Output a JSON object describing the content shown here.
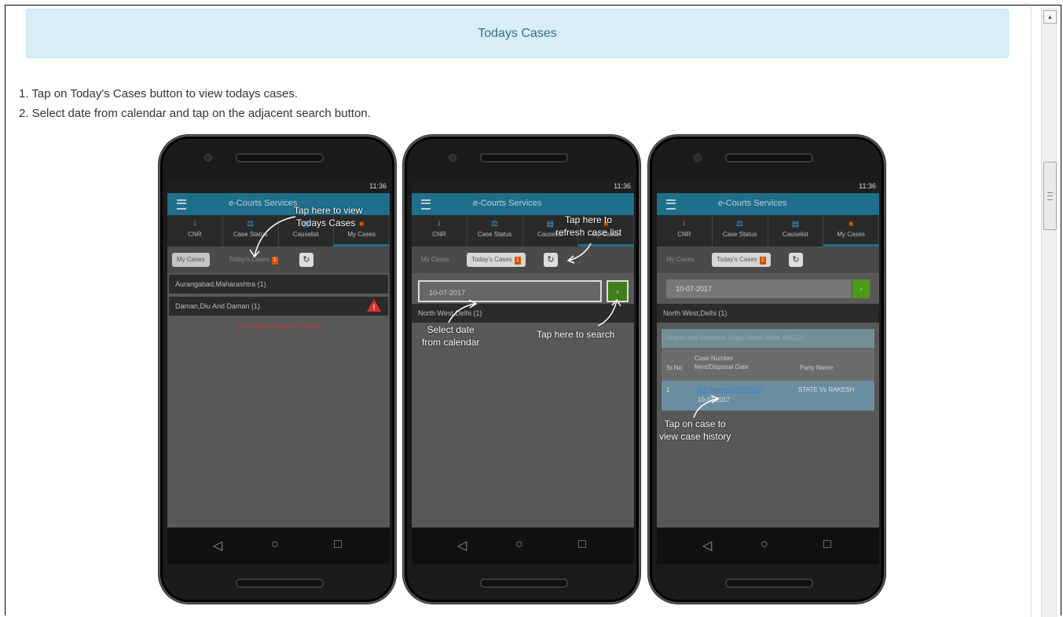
{
  "title": "Todays Cases",
  "instructions": [
    "1. Tap on Today's Cases button to view todays cases.",
    "2. Select date from calendar and tap on the adjacent search button."
  ],
  "phone": {
    "time": "11:36",
    "app_title": "e-Courts Services",
    "tabs": [
      "CNR",
      "Case Status",
      "Causelist",
      "My Cases"
    ],
    "my_cases": "My Cases",
    "todays_cases": "Today's Cases",
    "badge_count": "1"
  },
  "phone1": {
    "rows": [
      "Aurangabad,Maharashtra (1)",
      "Daman,Diu And Daman (1)"
    ],
    "error": "Connection Error in 1 Cases",
    "note": "Tap here to view\nTodays Cases"
  },
  "phone2": {
    "date": "10-07-2017",
    "row": "North West,Delhi (1)",
    "note_refresh": "Tap here to\nrefresh case list",
    "note_date": "Select date\nfrom calendar",
    "note_search": "Tap here to search"
  },
  "phone3": {
    "date": "10-07-2017",
    "row": "North West,Delhi (1)",
    "court": "District And Sessions Judge, North-West, RHC(1)",
    "headers": [
      "Sr.No",
      "Case Number\nNext/Disposal Date",
      "Party Name"
    ],
    "case_row": {
      "srno": "1",
      "case": "Bail Matters/2294/2017",
      "date": "10-07-2017",
      "party": "STATE Vs RAKESH"
    },
    "note": "Tap on case to\nview case history"
  },
  "icons": [
    "menu-icon",
    "info-icon",
    "scales-icon",
    "document-icon",
    "briefcase-icon",
    "refresh-icon",
    "warning-icon",
    "back-icon",
    "home-icon",
    "recents-icon",
    "arrow-icon"
  ]
}
